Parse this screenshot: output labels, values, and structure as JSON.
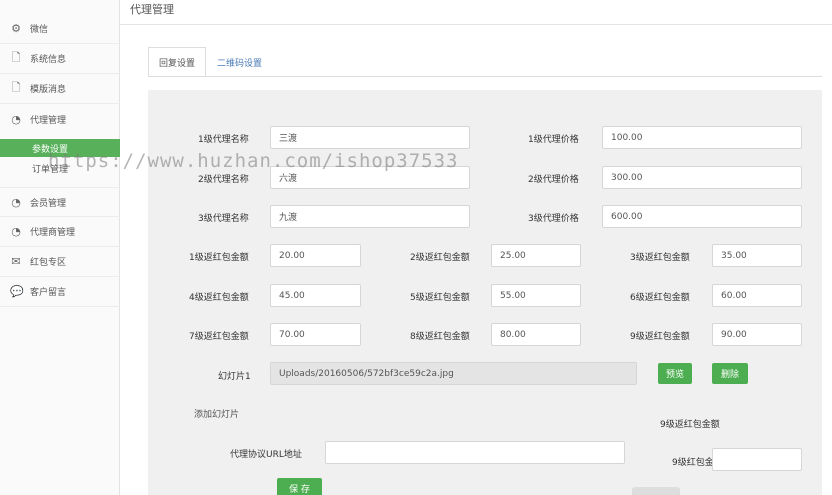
{
  "sidebar": {
    "items": [
      {
        "icon": "gears-icon",
        "glyph": "⚙",
        "label": "微信"
      },
      {
        "icon": "file-icon",
        "glyph": "🗋",
        "label": "系统信息"
      },
      {
        "icon": "file-icon",
        "glyph": "🗋",
        "label": "模版消息"
      },
      {
        "icon": "rss-icon",
        "glyph": "◔",
        "label": "代理管理"
      }
    ],
    "sub_items": [
      {
        "label": "参数设置",
        "active": true
      },
      {
        "label": "订单管理",
        "active": false
      }
    ],
    "items_after": [
      {
        "icon": "rss-icon",
        "glyph": "◔",
        "label": "会员管理"
      },
      {
        "icon": "rss-icon",
        "glyph": "◔",
        "label": "代理商管理"
      },
      {
        "icon": "envelope-icon",
        "glyph": "✉",
        "label": "红包专区"
      },
      {
        "icon": "comments-icon",
        "glyph": "💬",
        "label": "客户留言"
      }
    ]
  },
  "header": {
    "title": "代理管理"
  },
  "tabs": [
    {
      "label": "回复设置",
      "active": true
    },
    {
      "label": "二维码设置",
      "active": false
    }
  ],
  "form": {
    "agents": [
      {
        "name_label": "1级代理名称",
        "name_value": "三渡",
        "price_label": "1级代理价格",
        "price_value": "100.00"
      },
      {
        "name_label": "2级代理名称",
        "name_value": "六渡",
        "price_label": "2级代理价格",
        "price_value": "300.00"
      },
      {
        "name_label": "3级代理名称",
        "name_value": "九渡",
        "price_label": "3级代理价格",
        "price_value": "600.00"
      }
    ],
    "rebates": [
      {
        "label": "1级返红包金额",
        "value": "20.00"
      },
      {
        "label": "2级返红包金额",
        "value": "25.00"
      },
      {
        "label": "3级返红包金额",
        "value": "35.00"
      },
      {
        "label": "4级返红包金额",
        "value": "45.00"
      },
      {
        "label": "5级返红包金额",
        "value": "55.00"
      },
      {
        "label": "6级返红包金额",
        "value": "60.00"
      },
      {
        "label": "7级返红包金额",
        "value": "70.00"
      },
      {
        "label": "8级返红包金额",
        "value": "80.00"
      },
      {
        "label": "9级返红包金额",
        "value": "90.00"
      }
    ],
    "slide": {
      "label": "幻灯片1",
      "value": "Uploads/20160506/572bf3ce59c2a.jpg",
      "preview_label": "预览",
      "delete_label": "删除"
    },
    "add_slide_label": "添加幻灯片",
    "extra_rebate_label_1": "9级返红包金额",
    "extra_rebate_label_2": "9级红包金额",
    "extra_rebate_value": "",
    "agreement": {
      "label": "代理协议URL地址",
      "value": ""
    },
    "save_label": "保 存"
  },
  "watermark": "https://www.huzhan.com/ishop37533",
  "colors": {
    "accent": "#58b15a",
    "button": "#4cae50",
    "panel": "#f0f0f0"
  }
}
